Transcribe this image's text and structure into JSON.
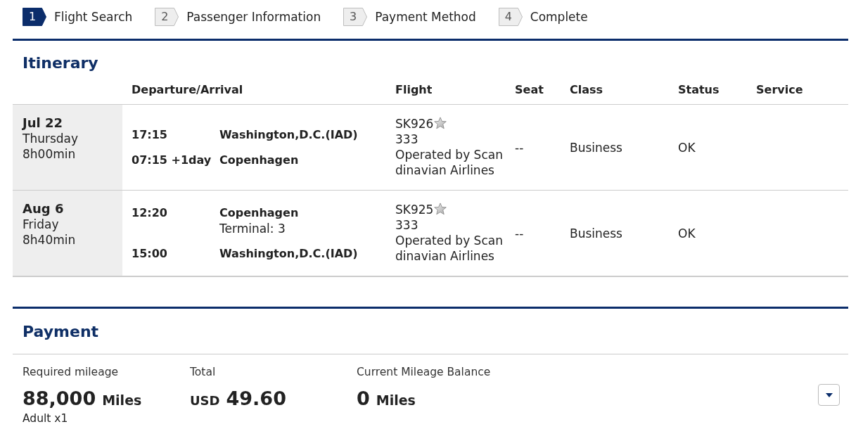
{
  "steps": [
    {
      "number": "1",
      "label": "Flight Search",
      "selected": true
    },
    {
      "number": "2",
      "label": "Passenger Information",
      "selected": false
    },
    {
      "number": "3",
      "label": "Payment Method",
      "selected": false
    },
    {
      "number": "4",
      "label": "Complete",
      "selected": false
    }
  ],
  "itinerary": {
    "title": "Itinerary",
    "columns": [
      "Departure/Arrival",
      "Flight",
      "Seat",
      "Class",
      "Status",
      "Service"
    ],
    "rows": [
      {
        "date": "Jul 22",
        "weekday": "Thursday",
        "duration": "8h00min",
        "segments": [
          {
            "time": "17:15",
            "place": "Washington,D.C.(IAD)"
          },
          {
            "time": "07:15 +1day",
            "place": "Copenhagen"
          }
        ],
        "flight": "SK926",
        "aircraft": "333",
        "operator": "Operated by Scandinavian Airlines",
        "seat": "--",
        "cabin_class": "Business",
        "status": "OK"
      },
      {
        "date": "Aug 6",
        "weekday": "Friday",
        "duration": "8h40min",
        "segments": [
          {
            "time": "12:20",
            "place": "Copenhagen",
            "terminal": "Terminal: 3"
          },
          {
            "time": "15:00",
            "place": "Washington,D.C.(IAD)"
          }
        ],
        "flight": "SK925",
        "aircraft": "333",
        "operator": "Operated by Scandinavian Airlines",
        "seat": "--",
        "cabin_class": "Business",
        "status": "OK"
      }
    ]
  },
  "payment": {
    "title": "Payment",
    "items": [
      {
        "kind": "miles",
        "label": "Required mileage",
        "amount": "88,000",
        "unit": "Miles",
        "note": "Adult x1"
      },
      {
        "kind": "money",
        "label": "Total",
        "amount": "49.60",
        "unit": "USD"
      },
      {
        "kind": "miles",
        "label": "Current Mileage Balance",
        "amount": "0",
        "unit": "Miles"
      }
    ]
  }
}
